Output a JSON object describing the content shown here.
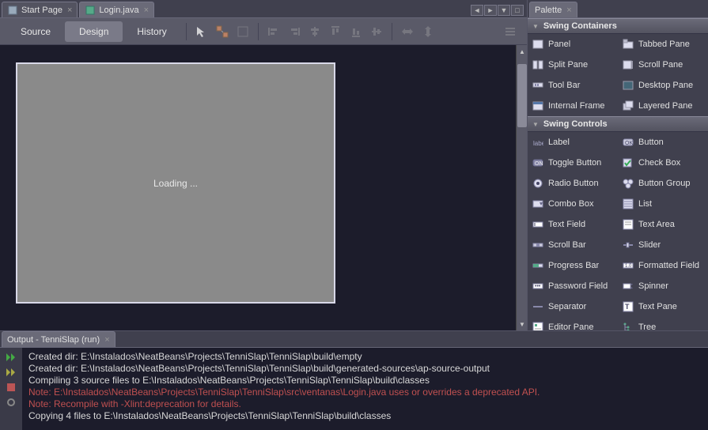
{
  "tabs": [
    {
      "title": "Start Page",
      "active": false
    },
    {
      "title": "Login.java",
      "active": true
    }
  ],
  "views": {
    "source": "Source",
    "design": "Design",
    "history": "History"
  },
  "canvas": {
    "loading": "Loading ..."
  },
  "palette": {
    "title": "Palette",
    "categories": [
      {
        "name": "Swing Containers",
        "items": [
          {
            "label": "Panel",
            "icon": "panel"
          },
          {
            "label": "Tabbed Pane",
            "icon": "tabbed"
          },
          {
            "label": "Split Pane",
            "icon": "split"
          },
          {
            "label": "Scroll Pane",
            "icon": "scroll"
          },
          {
            "label": "Tool Bar",
            "icon": "toolbar"
          },
          {
            "label": "Desktop Pane",
            "icon": "desktop"
          },
          {
            "label": "Internal Frame",
            "icon": "frame"
          },
          {
            "label": "Layered Pane",
            "icon": "layered"
          }
        ]
      },
      {
        "name": "Swing Controls",
        "items": [
          {
            "label": "Label",
            "icon": "label"
          },
          {
            "label": "Button",
            "icon": "button"
          },
          {
            "label": "Toggle Button",
            "icon": "toggle"
          },
          {
            "label": "Check Box",
            "icon": "check"
          },
          {
            "label": "Radio Button",
            "icon": "radio"
          },
          {
            "label": "Button Group",
            "icon": "group"
          },
          {
            "label": "Combo Box",
            "icon": "combo"
          },
          {
            "label": "List",
            "icon": "list"
          },
          {
            "label": "Text Field",
            "icon": "textfield"
          },
          {
            "label": "Text Area",
            "icon": "textarea"
          },
          {
            "label": "Scroll Bar",
            "icon": "scrollbar"
          },
          {
            "label": "Slider",
            "icon": "slider"
          },
          {
            "label": "Progress Bar",
            "icon": "progress"
          },
          {
            "label": "Formatted Field",
            "icon": "formatted"
          },
          {
            "label": "Password Field",
            "icon": "password"
          },
          {
            "label": "Spinner",
            "icon": "spinner"
          },
          {
            "label": "Separator",
            "icon": "separator"
          },
          {
            "label": "Text Pane",
            "icon": "textpane"
          },
          {
            "label": "Editor Pane",
            "icon": "editor"
          },
          {
            "label": "Tree",
            "icon": "tree"
          }
        ]
      }
    ]
  },
  "output": {
    "title": "Output - TenniSlap (run)",
    "lines": [
      {
        "text": "Created dir: E:\\Instalados\\NeatBeans\\Projects\\TenniSlap\\TenniSlap\\build\\empty",
        "warn": false
      },
      {
        "text": "Created dir: E:\\Instalados\\NeatBeans\\Projects\\TenniSlap\\TenniSlap\\build\\generated-sources\\ap-source-output",
        "warn": false
      },
      {
        "text": "Compiling 3 source files to E:\\Instalados\\NeatBeans\\Projects\\TenniSlap\\TenniSlap\\build\\classes",
        "warn": false
      },
      {
        "text": "Note: E:\\Instalados\\NeatBeans\\Projects\\TenniSlap\\TenniSlap\\src\\ventanas\\Login.java uses or overrides a deprecated API.",
        "warn": true
      },
      {
        "text": "Note: Recompile with -Xlint:deprecation for details.",
        "warn": true
      },
      {
        "text": "Copying 4 files to E:\\Instalados\\NeatBeans\\Projects\\TenniSlap\\TenniSlap\\build\\classes",
        "warn": false
      }
    ]
  }
}
